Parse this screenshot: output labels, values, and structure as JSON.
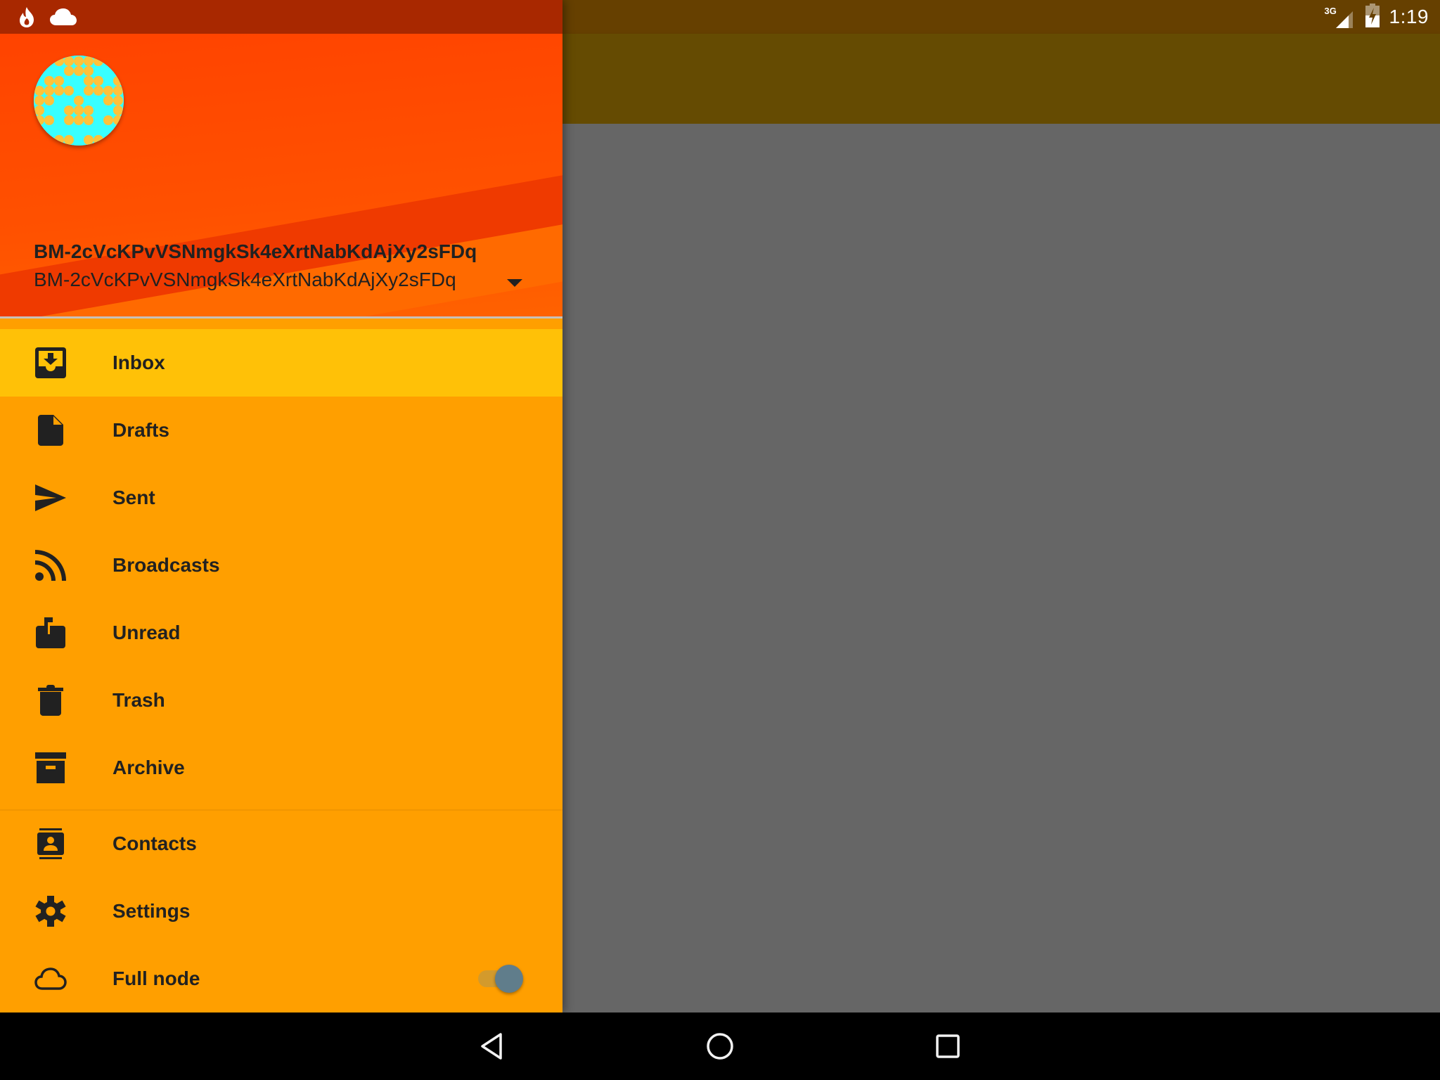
{
  "status_bar": {
    "left_icons": [
      "flame-icon",
      "cloud-icon"
    ],
    "network_label": "3G",
    "time": "1:19",
    "colors": {
      "drawer_status": "#a82800",
      "app_status": "#664000"
    }
  },
  "drawer": {
    "header": {
      "name": "BM-2cVcKPvVSNmgkSk4eXrtNabKdAjXy2sFDq",
      "address": "BM-2cVcKPvVSNmgkSk4eXrtNabKdAjXy2sFDq",
      "avatar_colors": {
        "background": "#38ffff",
        "dots": "#ffc23b"
      },
      "dropdown_icon": "arrow-drop-down-icon"
    },
    "primary_items": [
      {
        "label": "Inbox",
        "icon": "inbox-icon",
        "selected": true
      },
      {
        "label": "Drafts",
        "icon": "draft-file-icon",
        "selected": false
      },
      {
        "label": "Sent",
        "icon": "send-icon",
        "selected": false
      },
      {
        "label": "Broadcasts",
        "icon": "rss-icon",
        "selected": false
      },
      {
        "label": "Unread",
        "icon": "mailbox-icon",
        "selected": false
      },
      {
        "label": "Trash",
        "icon": "trash-icon",
        "selected": false
      },
      {
        "label": "Archive",
        "icon": "archive-icon",
        "selected": false
      }
    ],
    "secondary_items": [
      {
        "label": "Contacts",
        "icon": "contacts-icon"
      },
      {
        "label": "Settings",
        "icon": "gear-icon"
      },
      {
        "label": "Full node",
        "icon": "cloud-outline-icon",
        "toggle_on": true
      }
    ],
    "colors": {
      "background": "#ff9f00",
      "selected": "#ffc107",
      "header": "#ff4e00",
      "text": "#212121",
      "toggle_knob": "#607d8b"
    }
  },
  "app": {
    "toolbar_color": "#654b02",
    "content_color": "#666666"
  },
  "nav_bar": {
    "buttons": [
      "back",
      "home",
      "recents"
    ]
  }
}
